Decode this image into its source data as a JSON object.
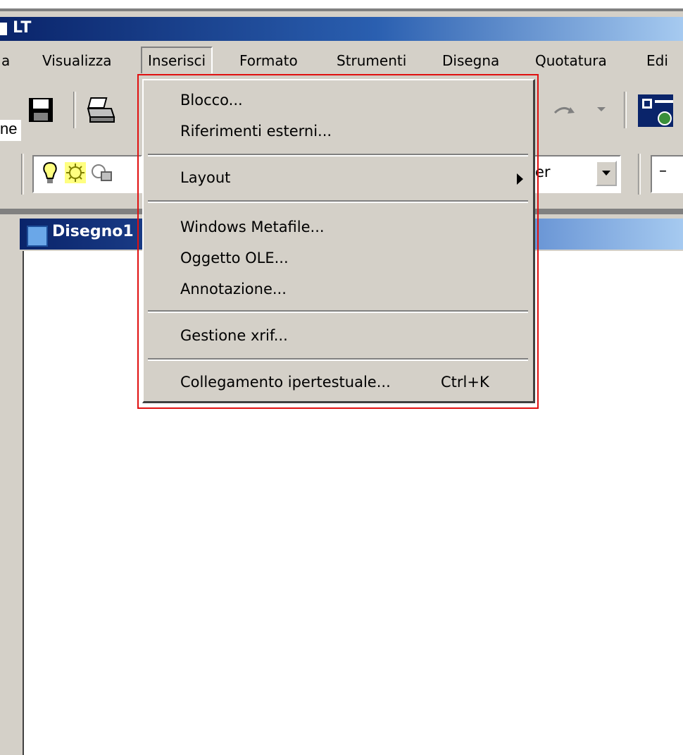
{
  "window": {
    "title": "LT"
  },
  "menubar": {
    "items": [
      {
        "label": "a"
      },
      {
        "label": "Visualizza"
      },
      {
        "label": "Inserisci"
      },
      {
        "label": "Formato"
      },
      {
        "label": "Strumenti"
      },
      {
        "label": "Disegna"
      },
      {
        "label": "Quotatura"
      },
      {
        "label": "Edi"
      }
    ]
  },
  "side_label": "ne",
  "toolbar2": {
    "layer_combo_text": "er",
    "line_combo_text": "–"
  },
  "document": {
    "title": "Disegno1"
  },
  "dropdown": {
    "items": [
      {
        "label": "Blocco..."
      },
      {
        "label": "Riferimenti esterni..."
      },
      {
        "label": "Layout"
      },
      {
        "label": "Windows Metafile..."
      },
      {
        "label": "Oggetto OLE..."
      },
      {
        "label": "Annotazione..."
      },
      {
        "label": "Gestione xrif..."
      },
      {
        "label": "Collegamento ipertestuale...",
        "shortcut": "Ctrl+K"
      }
    ]
  },
  "icons": {
    "save": "save-icon",
    "print": "print-icon",
    "redo": "redo-icon",
    "lightbulb": "lightbulb-icon",
    "sun": "sun-freeze-icon",
    "lock": "layer-lock-icon",
    "design-center": "design-center-icon",
    "document": "drawing-document-icon",
    "submenu": "submenu-arrow-icon"
  },
  "colors": {
    "title_gradient_start": "#0a246a",
    "menu_bg": "#d4d0c8",
    "annotation_red": "#e01010"
  }
}
